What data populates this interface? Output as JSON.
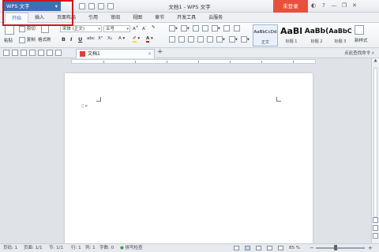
{
  "titlebar": {
    "app_button": "WPS 文字",
    "app_caret": "▾",
    "window_title": "文档1 - WPS 文字",
    "login": "未登录",
    "icons": [
      "skin-icon",
      "help-icon",
      "minimize-icon",
      "restore-icon",
      "close-icon"
    ],
    "icon_glyphs": [
      "◐",
      "?",
      "—",
      "❐",
      "✕"
    ]
  },
  "tabs": [
    "开始",
    "插入",
    "页面布局",
    "引用",
    "审阅",
    "视图",
    "章节",
    "开发工具",
    "云服务"
  ],
  "ribbon": {
    "paste": "粘贴",
    "cut": "剪切",
    "copy": "复制",
    "format_painter": "格式刷",
    "font_name": "宋体 (正文)",
    "font_size": "五号",
    "bold": "B",
    "italic": "I",
    "underline": "U",
    "styles": [
      {
        "preview": "AaBbCcDd",
        "label": "正文"
      },
      {
        "preview": "AaBl",
        "label": "标题 1"
      },
      {
        "preview": "AaBb(",
        "label": "标题 2"
      },
      {
        "preview": "AaBbC",
        "label": "标题 3"
      }
    ],
    "new_style": "新样式"
  },
  "doc_tabs": {
    "doc_name": "文档1",
    "close": "×",
    "new_tab": "+",
    "find_command": "点此查找命令"
  },
  "statusbar": {
    "page": "页码: 1",
    "pages": "页面: 1/1",
    "section": "节: 1/1",
    "row": "行: 1",
    "col": "列: 1",
    "words": "字数: 0",
    "spell": "拼写检查",
    "zoom": "85 %",
    "zoom_level": 0.38,
    "minus": "−",
    "plus": "+"
  }
}
